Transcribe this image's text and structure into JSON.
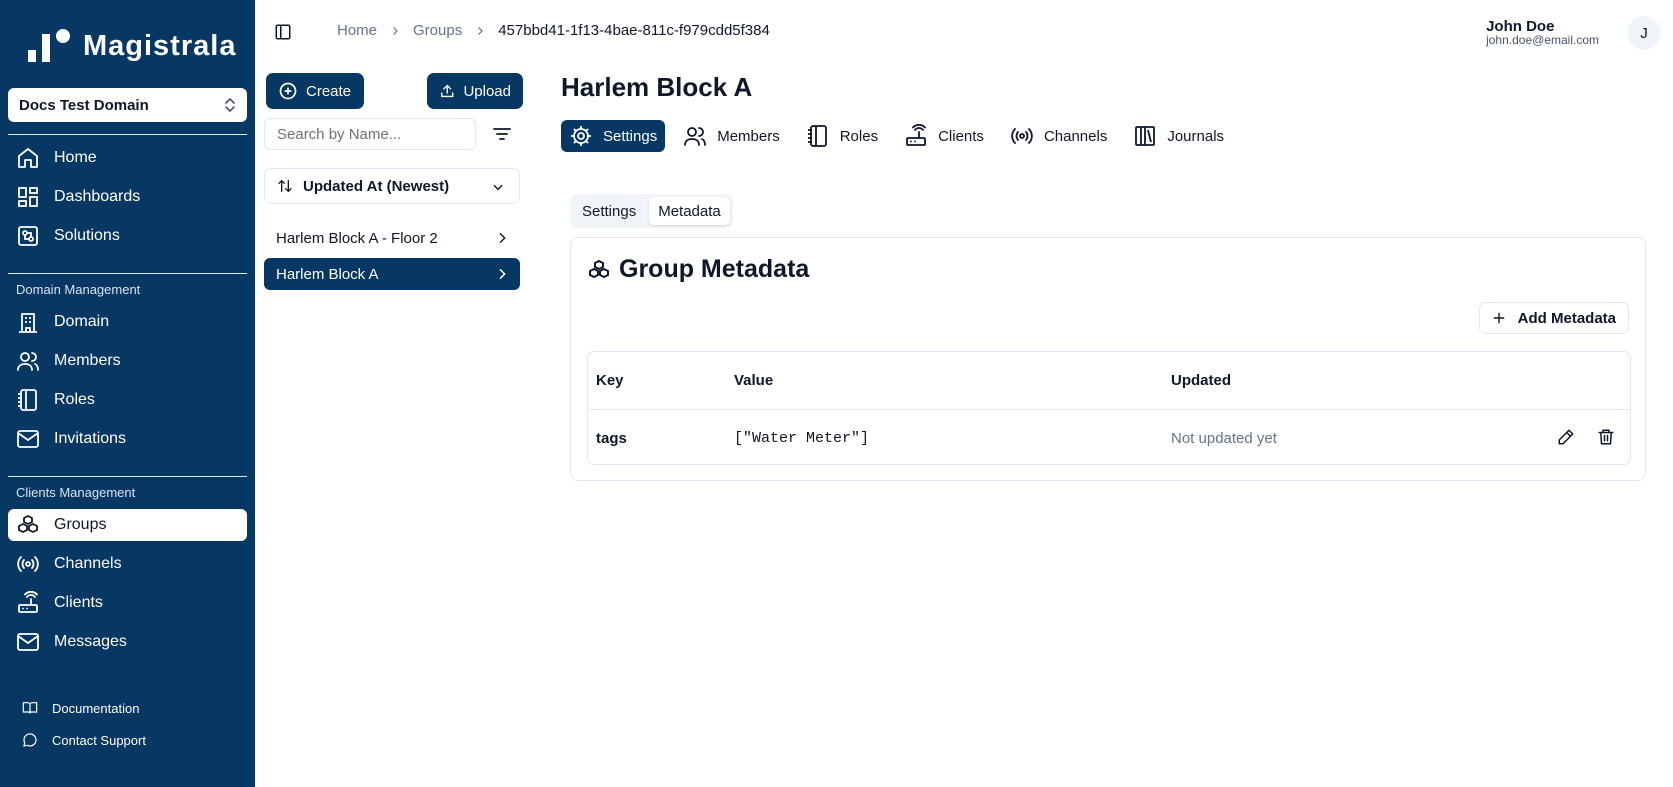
{
  "app": {
    "brand": "Magistrala",
    "domain_selector": "Docs Test Domain"
  },
  "sidebar": {
    "main_items": [
      {
        "label": "Home",
        "icon": "home-icon"
      },
      {
        "label": "Dashboards",
        "icon": "dashboard-icon"
      },
      {
        "label": "Solutions",
        "icon": "solutions-icon"
      }
    ],
    "domain_section": "Domain Management",
    "domain_items": [
      {
        "label": "Domain",
        "icon": "building-icon"
      },
      {
        "label": "Members",
        "icon": "users-icon"
      },
      {
        "label": "Roles",
        "icon": "notebook-icon"
      },
      {
        "label": "Invitations",
        "icon": "mail-icon"
      }
    ],
    "clients_section": "Clients Management",
    "clients_items": [
      {
        "label": "Groups",
        "icon": "boxes-icon",
        "active": true
      },
      {
        "label": "Channels",
        "icon": "radio-icon"
      },
      {
        "label": "Clients",
        "icon": "router-icon"
      },
      {
        "label": "Messages",
        "icon": "mail-check-icon"
      }
    ],
    "footer": [
      {
        "label": "Documentation",
        "icon": "book-icon"
      },
      {
        "label": "Contact Support",
        "icon": "chat-icon"
      }
    ]
  },
  "breadcrumb": [
    "Home",
    "Groups",
    "457bbd41-1f13-4bae-811c-f979cdd5f384"
  ],
  "user": {
    "name": "John Doe",
    "email": "john.doe@email.com",
    "initial": "J"
  },
  "list_panel": {
    "create_label": "Create",
    "upload_label": "Upload",
    "search_placeholder": "Search by Name...",
    "sort_label": "Updated At (Newest)",
    "items": [
      {
        "label": "Harlem Block A - Floor 2",
        "active": false
      },
      {
        "label": "Harlem Block A",
        "active": true
      }
    ]
  },
  "main": {
    "title": "Harlem Block A",
    "tabs": [
      {
        "label": "Settings",
        "icon": "gear-icon",
        "active": true
      },
      {
        "label": "Members",
        "icon": "users-icon"
      },
      {
        "label": "Roles",
        "icon": "notebook-icon"
      },
      {
        "label": "Clients",
        "icon": "router-icon"
      },
      {
        "label": "Channels",
        "icon": "radio-icon"
      },
      {
        "label": "Journals",
        "icon": "library-icon"
      }
    ],
    "subtabs": [
      {
        "label": "Settings",
        "active": false
      },
      {
        "label": "Metadata",
        "active": true
      }
    ],
    "card_title": "Group Metadata",
    "add_label": "Add Metadata",
    "table": {
      "headers": [
        "Key",
        "Value",
        "Updated"
      ],
      "rows": [
        {
          "key": "tags",
          "value": "[\"Water Meter\"]",
          "updated": "Not updated yet"
        }
      ]
    }
  },
  "colors": {
    "brand": "#073763",
    "border": "#e2e8f0",
    "muted": "#64748b"
  }
}
